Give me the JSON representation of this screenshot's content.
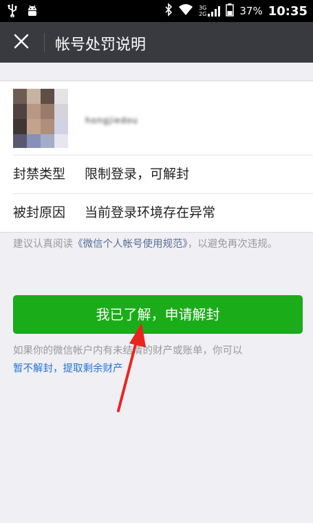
{
  "status_bar": {
    "battery": "37%",
    "time": "10:35",
    "signal_label_top": "3G",
    "signal_label_bottom": "2G"
  },
  "header": {
    "title": "帐号处罚说明"
  },
  "account": {
    "username_blurred": "hongjiedou"
  },
  "details": {
    "ban_type_label": "封禁类型",
    "ban_type_value": "限制登录，可解封",
    "reason_label": "被封原因",
    "reason_value": "当前登录环境存在异常"
  },
  "notice": {
    "prefix": "建议认真阅读",
    "link": "《微信个人帐号使用规范》",
    "suffix": "，以避免再次违规。"
  },
  "apply_button": {
    "label": "我已了解，申请解封"
  },
  "footer": {
    "text": "如果你的微信帐户内有未结清的财产或账单，你可以",
    "link": "暂不解封，提取剩余财产"
  },
  "colors": {
    "header_bg": "#393a3f",
    "button_green": "#1aad19",
    "link_blue": "#576b95",
    "annotation_arrow": "#e8261f"
  }
}
